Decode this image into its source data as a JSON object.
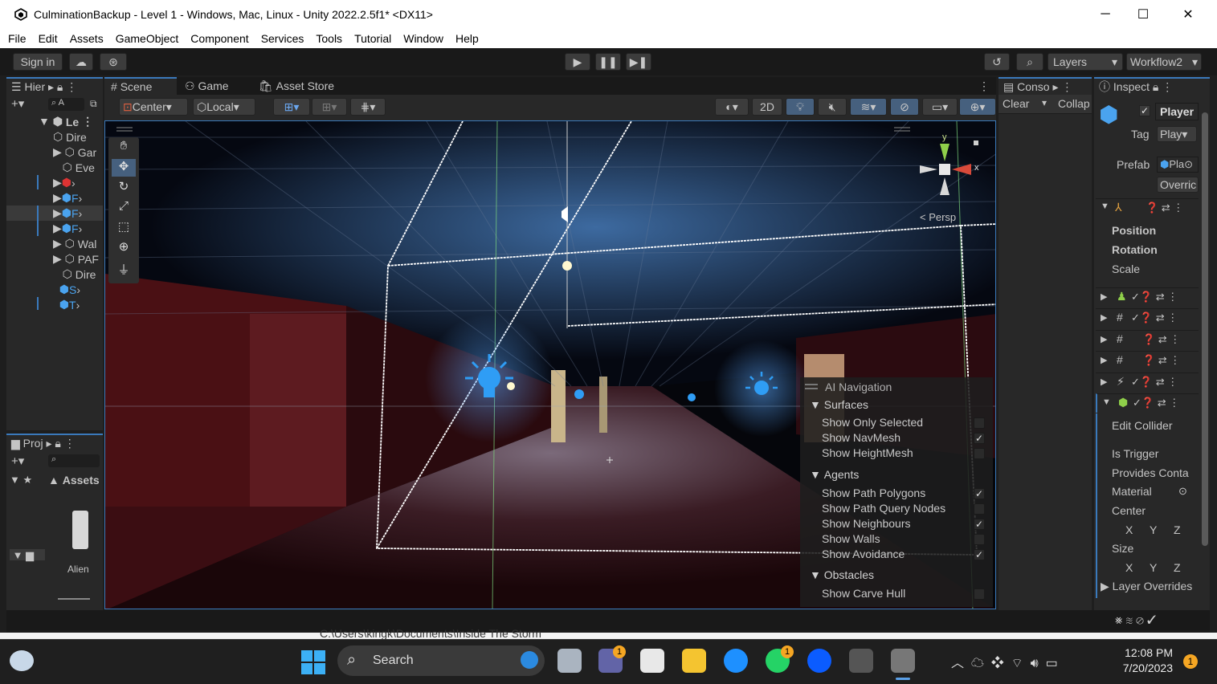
{
  "window": {
    "title": "CulminationBackup - Level 1 - Windows, Mac, Linux - Unity 2022.2.5f1* <DX11>",
    "minimize": "─",
    "maximize": "☐",
    "close": "✕"
  },
  "menu": [
    "File",
    "Edit",
    "Assets",
    "GameObject",
    "Component",
    "Services",
    "Tools",
    "Tutorial",
    "Window",
    "Help"
  ],
  "toolbar": {
    "sign_in": "Sign in",
    "layers": "Layers",
    "layout": "Workflow2"
  },
  "hierarchy": {
    "tab": "Hier",
    "scene_root": "Le",
    "items": [
      "Dire",
      "Gar",
      "Eve",
      "",
      "F",
      "F",
      "F",
      "Wal",
      "PAF",
      "Dire",
      "S",
      "T"
    ]
  },
  "scene_view": {
    "tabs": [
      "Scene",
      "Game",
      "Asset Store"
    ],
    "pivot": "Center",
    "space": "Local",
    "mode_2d": "2D",
    "persp_label": "< Persp",
    "gizmo_y": "y",
    "gizmo_x": "x"
  },
  "ai_navigation": {
    "title": "AI Navigation",
    "surfaces_header": "Surfaces",
    "surfaces": [
      {
        "label": "Show Only Selected",
        "checked": false
      },
      {
        "label": "Show NavMesh",
        "checked": true
      },
      {
        "label": "Show HeightMesh",
        "checked": false
      }
    ],
    "agents_header": "Agents",
    "agents": [
      {
        "label": "Show Path Polygons",
        "checked": true
      },
      {
        "label": "Show Path Query Nodes",
        "checked": false
      },
      {
        "label": "Show Neighbours",
        "checked": true
      },
      {
        "label": "Show Walls",
        "checked": false
      },
      {
        "label": "Show Avoidance",
        "checked": true
      }
    ],
    "obstacles_header": "Obstacles",
    "obstacles": [
      {
        "label": "Show Carve Hull",
        "checked": false
      }
    ]
  },
  "console": {
    "tab": "Conso",
    "clear": "Clear",
    "collapse": "Collap"
  },
  "project": {
    "tab": "Proj",
    "assets_label": "Assets",
    "asset_item": "Alien"
  },
  "inspector": {
    "tab": "Inspect",
    "object_name": "Player",
    "tag_label": "Tag",
    "tag_value": "Play",
    "prefab_label": "Prefab",
    "prefab_value": "Pla",
    "overrides": "Overric",
    "transform": [
      "Position",
      "Rotation",
      "Scale"
    ],
    "collider": {
      "edit": "Edit Collider",
      "is_trigger": "Is Trigger",
      "provides": "Provides Conta",
      "material": "Material",
      "center": "Center",
      "size": "Size",
      "x": "X",
      "y": "Y",
      "z": "Z",
      "layer_overrides": "Layer Overrides"
    }
  },
  "status": {
    "path": "C:\\Users\\kingk\\Documents\\Inside The Storm"
  },
  "taskbar": {
    "search": "Search",
    "time": "12:08 PM",
    "date": "7/20/2023",
    "notif_count": "1",
    "badge_teams": "1",
    "badge_whatsapp": "1"
  },
  "colors": {
    "accent": "#3a79bb",
    "panel": "#282828",
    "darkbar": "#191919",
    "scene_red": "#4a1014",
    "light_blue": "#2f9df5"
  }
}
